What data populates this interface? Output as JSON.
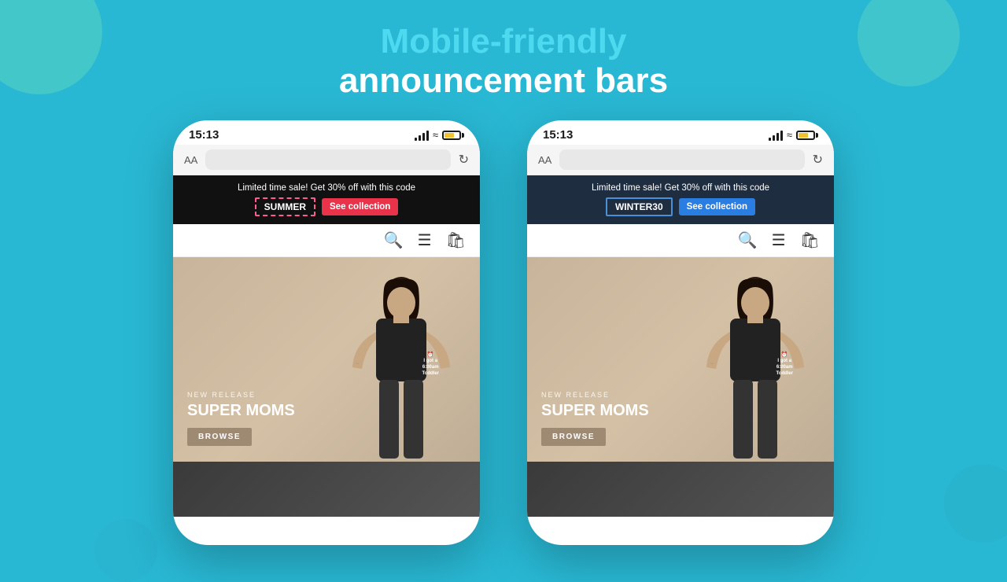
{
  "background": {
    "color": "#29b8d4"
  },
  "header": {
    "highlight_text": "Mobile-friendly",
    "normal_text": "announcement bars"
  },
  "phone_left": {
    "status": {
      "time": "15:13"
    },
    "announcement": {
      "text": "Limited time sale! Get 30% off with this code",
      "code_label": "SUMMER",
      "cta_label": "See collection"
    },
    "hero": {
      "new_release_label": "NEW RELEASE",
      "title": "SUPER MOMS",
      "browse_label": "BROWSE"
    }
  },
  "phone_right": {
    "status": {
      "time": "15:13"
    },
    "announcement": {
      "text": "Limited time sale! Get 30% off with this code",
      "code_label": "WINTER30",
      "cta_label": "See collection"
    },
    "hero": {
      "new_release_label": "NEW RELEASE",
      "title": "SUPER MOMS",
      "browse_label": "BROWSE"
    }
  }
}
